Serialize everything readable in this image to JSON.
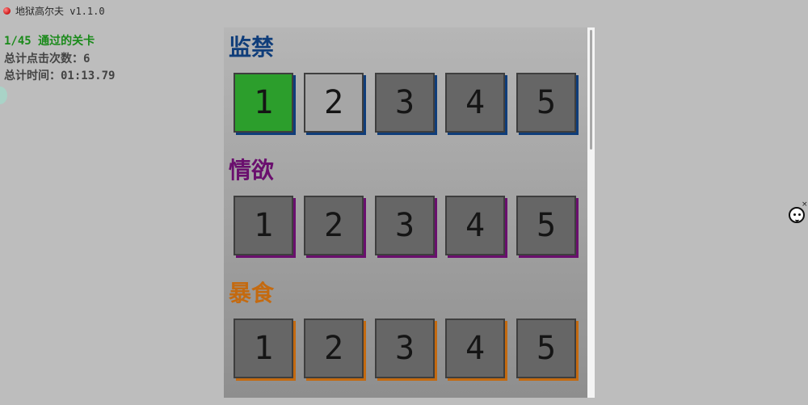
{
  "window": {
    "title": "地狱高尔夫 v1.1.0"
  },
  "stats": {
    "levels_passed": "1/45 通过的关卡",
    "total_clicks": "总计点击次数：6",
    "total_time": "总计时间：01:13.79"
  },
  "colors": {
    "accent_green": "#1a8a1a",
    "cleared_tile": "#2c9e2c",
    "current_tile": "#a6a6a6",
    "locked_tile": "#666666"
  },
  "sections": [
    {
      "title": "监禁",
      "color": "#0f3d7a",
      "levels": [
        "1",
        "2",
        "3",
        "4",
        "5"
      ],
      "states": [
        "cleared",
        "current",
        "locked",
        "locked",
        "locked"
      ]
    },
    {
      "title": "情欲",
      "color": "#6a0f6e",
      "levels": [
        "1",
        "2",
        "3",
        "4",
        "5"
      ],
      "states": [
        "locked",
        "locked",
        "locked",
        "locked",
        "locked"
      ]
    },
    {
      "title": "暴食",
      "color": "#c46a10",
      "levels": [
        "1",
        "2",
        "3",
        "4",
        "5"
      ],
      "states": [
        "locked",
        "locked",
        "locked",
        "locked",
        "locked"
      ]
    }
  ],
  "corner_widget": {
    "close_label": "×",
    "icon": "smiley-icon"
  }
}
